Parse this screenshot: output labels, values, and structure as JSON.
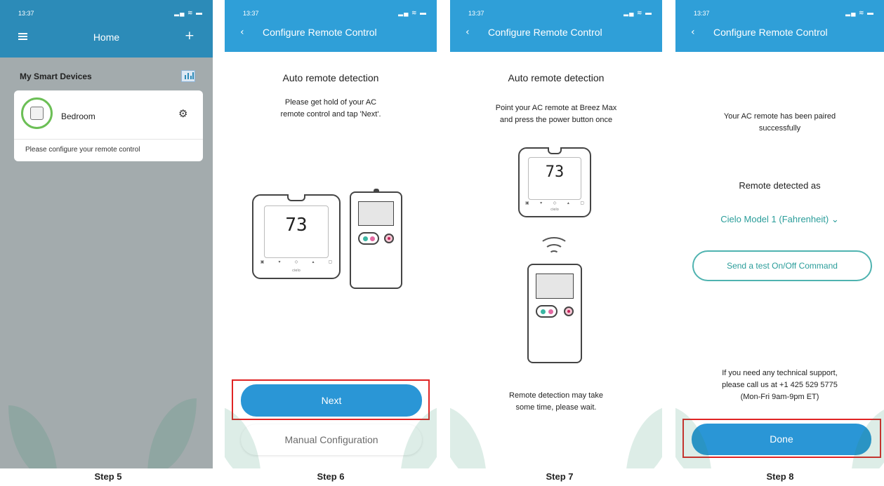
{
  "step5": {
    "status_time": "13:37",
    "status_icons": "▂▄ ≋ ▬",
    "title": "Home",
    "section_title": "My Smart Devices",
    "device_name": "Bedroom",
    "device_note": "Please configure your remote control",
    "step_label": "Step 5"
  },
  "step6": {
    "status_time": "13:37",
    "status_icons": "▂▄ ≋ ▬",
    "back": "‹",
    "title": "Configure Remote Control",
    "heading": "Auto remote detection",
    "instruction_line1": "Please get hold of your AC",
    "instruction_line2": "remote control and tap 'Next'.",
    "thermostat_reading": "73",
    "next_label": "Next",
    "manual_label": "Manual Configuration",
    "step_label": "Step 6"
  },
  "step7": {
    "status_time": "13:37",
    "status_icons": "▂▄ ≋ ▬",
    "back": "‹",
    "title": "Configure Remote Control",
    "heading": "Auto remote detection",
    "instruction_line1": "Point your AC remote at Breez Max",
    "instruction_line2": "and press the power button once",
    "thermostat_reading": "73",
    "wait_line1": "Remote detection may take",
    "wait_line2": "some time, please wait.",
    "step_label": "Step 7"
  },
  "step8": {
    "status_time": "13:37",
    "status_icons": "▂▄ ≋ ▬",
    "back": "‹",
    "title": "Configure Remote Control",
    "paired_line1": "Your AC remote has been paired",
    "paired_line2": "successfully",
    "detected_as": "Remote detected as",
    "model": "Cielo Model 1 (Fahrenheit)",
    "model_chevron": "⌄",
    "test_button": "Send a test On/Off Command",
    "support_line1": "If you need any technical support,",
    "support_line2": "please call us at +1 425 529 5775",
    "support_line3": "(Mon-Fri 9am-9pm ET)",
    "done_label": "Done",
    "step_label": "Step 8"
  },
  "colors": {
    "header_blue": "#2f9fd8",
    "home_header": "#2c8bb8",
    "button_blue": "#2a96d6",
    "teal_accent": "#2a9d9a",
    "highlight_red": "#e02424",
    "device_ring_green": "#6cbf56"
  }
}
